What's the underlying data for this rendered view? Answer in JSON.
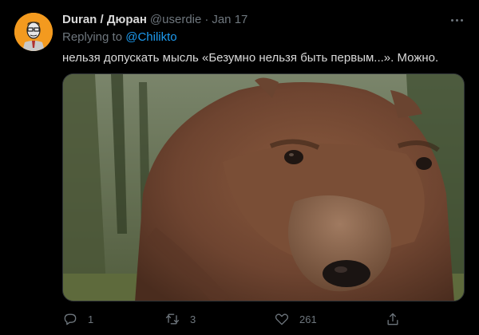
{
  "tweet": {
    "author_name": "Duran / Дюран",
    "handle": "@userdie",
    "separator": "·",
    "time": "Jan 17",
    "replying_prefix": "Replying to",
    "replying_to": "@Chilikto",
    "text": "нельзя допускать мысль «Безумно нельзя быть первым...». Можно."
  },
  "actions": {
    "reply_count": "1",
    "retweet_count": "3",
    "like_count": "261"
  },
  "icons": {
    "avatar": "avatar-icon",
    "more": "more-icon",
    "reply": "reply-icon",
    "retweet": "retweet-icon",
    "like": "heart-icon",
    "share": "share-icon"
  },
  "colors": {
    "background": "#000000",
    "text": "#d9d9d9",
    "muted": "#6e767d",
    "link": "#1d9bf0",
    "avatar_bg": "#f39a1f"
  }
}
